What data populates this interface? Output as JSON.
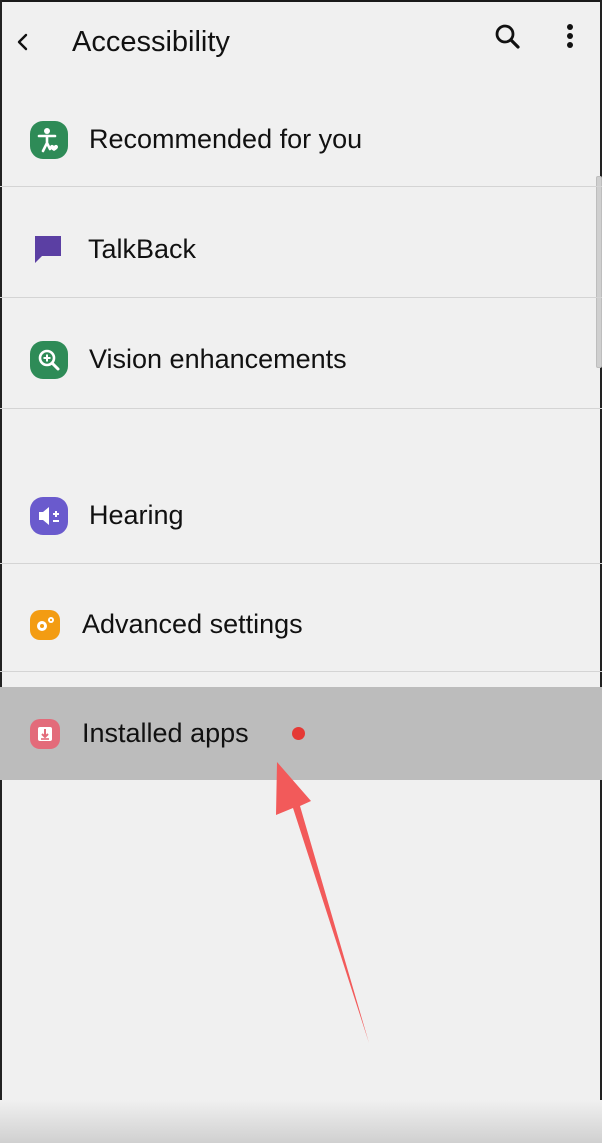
{
  "header": {
    "title": "Accessibility",
    "back_icon": "chevron-left-icon",
    "search_icon": "search-icon",
    "more_icon": "more-vertical-icon"
  },
  "menu": {
    "items": [
      {
        "label": "Recommended for you",
        "icon": "accessibility-person-icon",
        "color": "#2e8b57"
      },
      {
        "label": "TalkBack",
        "icon": "speech-bubble-icon",
        "color": "#5b3fa3"
      },
      {
        "label": "Vision enhancements",
        "icon": "magnifier-icon",
        "color": "#2e8b57"
      },
      {
        "label": "Hearing",
        "icon": "speaker-icon",
        "color": "#6a5acd"
      },
      {
        "label": "Advanced settings",
        "icon": "gears-icon",
        "color": "#f39c12"
      },
      {
        "label": "Installed apps",
        "icon": "download-icon",
        "color": "#e36b7a",
        "selected": true,
        "has_notification": true
      }
    ]
  },
  "annotation": {
    "arrow_color": "#f25a5a"
  }
}
